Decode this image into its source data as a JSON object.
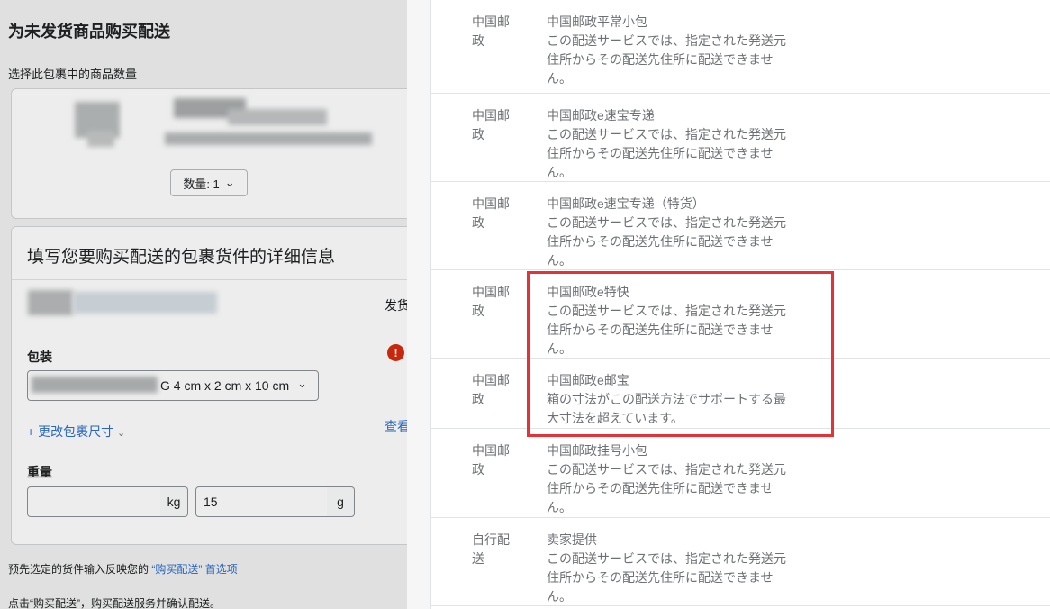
{
  "left": {
    "title": "为未发货商品购买配送",
    "quantity_section_label": "选择此包裹中的商品数量",
    "quantity_select": "数量: 1",
    "details_title": "填写您要购买配送的包裹货件的详细信息",
    "ship_from_label": "发货",
    "package_label": "包装",
    "package_select": "G 4 cm x 2 cm x 10 cm",
    "change_size_link": "+ 更改包裹尺寸",
    "view_link": "查看",
    "weight_label": "重量",
    "weight_unit_kg": "kg",
    "weight_g_value": "15",
    "weight_unit_g": "g",
    "footer_note_prefix": "预先选定的货件输入反映您的",
    "footer_note_link1": "“购买配送”",
    "footer_note_link2": "首选项",
    "footer_note2": "点击“购买配送”，购买配送服务并确认配送。"
  },
  "shipping_options": [
    {
      "carrier": "中国邮政",
      "service": "中国邮政平常小包",
      "note": "この配送サービスでは、指定された発送元住所からその配送先住所に配送できません。"
    },
    {
      "carrier": "中国邮政",
      "service": "中国邮政e速宝专递",
      "note": "この配送サービスでは、指定された発送元住所からその配送先住所に配送できません。"
    },
    {
      "carrier": "中国邮政",
      "service": "中国邮政e速宝专递（特货）",
      "note": "この配送サービスでは、指定された発送元住所からその配送先住所に配送できません。"
    },
    {
      "carrier": "中国邮政",
      "service": "中国邮政e特快",
      "note": "この配送サービスでは、指定された発送元住所からその配送先住所に配送できません。"
    },
    {
      "carrier": "中国邮政",
      "service": "中国邮政e邮宝",
      "note": "箱の寸法がこの配送方法でサポートする最大寸法を超えています。"
    },
    {
      "carrier": "中国邮政",
      "service": "中国邮政挂号小包",
      "note": "この配送サービスでは、指定された発送元住所からその配送先住所に配送できません。"
    },
    {
      "carrier": "自行配送",
      "service": "卖家提供",
      "note": "この配送サービスでは、指定された発送元住所からその配送先住所に配送できません。"
    }
  ],
  "colors": {
    "highlight": "#e53238",
    "link": "#2c6ecb",
    "muted_text": "#6d7175",
    "error": "#d72c0d"
  },
  "icons": [
    "chevron-down-icon",
    "error-icon"
  ]
}
